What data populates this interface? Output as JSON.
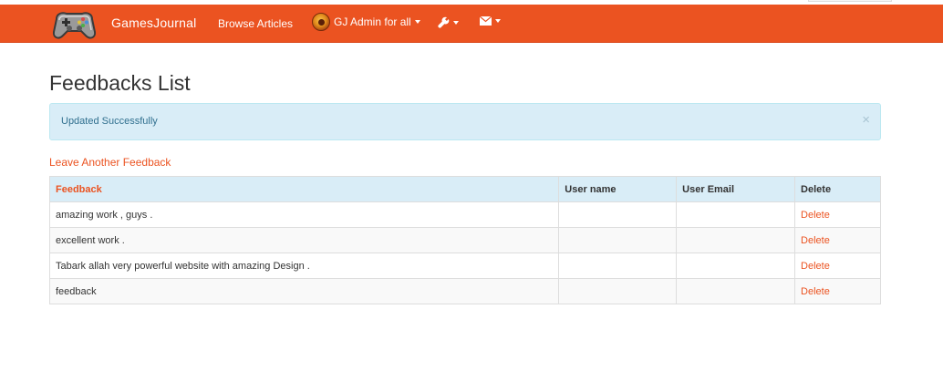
{
  "navbar": {
    "brand": "GamesJournal",
    "browse_label": "Browse Articles",
    "user_label": "GJ Admin for all",
    "icons": [
      "gamepad-icon",
      "wrench-icon",
      "envelope-icon"
    ],
    "bg_color": "#eb5321"
  },
  "page": {
    "title": "Feedbacks List"
  },
  "alert": {
    "message": "Updated Successfully",
    "close_glyph": "×"
  },
  "leave_link": "Leave Another Feedback",
  "table": {
    "headers": {
      "feedback": "Feedback",
      "user_name": "User name",
      "user_email": "User Email",
      "delete": "Delete"
    },
    "rows": [
      {
        "feedback": "amazing work , guys .",
        "user_name": "",
        "user_email": "",
        "action": "Delete"
      },
      {
        "feedback": "excellent work .",
        "user_name": "",
        "user_email": "",
        "action": "Delete"
      },
      {
        "feedback": "Tabark allah very powerful website with amazing Design .",
        "user_name": "",
        "user_email": "",
        "action": "Delete"
      },
      {
        "feedback": "feedback",
        "user_name": "",
        "user_email": "",
        "action": "Delete"
      }
    ]
  }
}
